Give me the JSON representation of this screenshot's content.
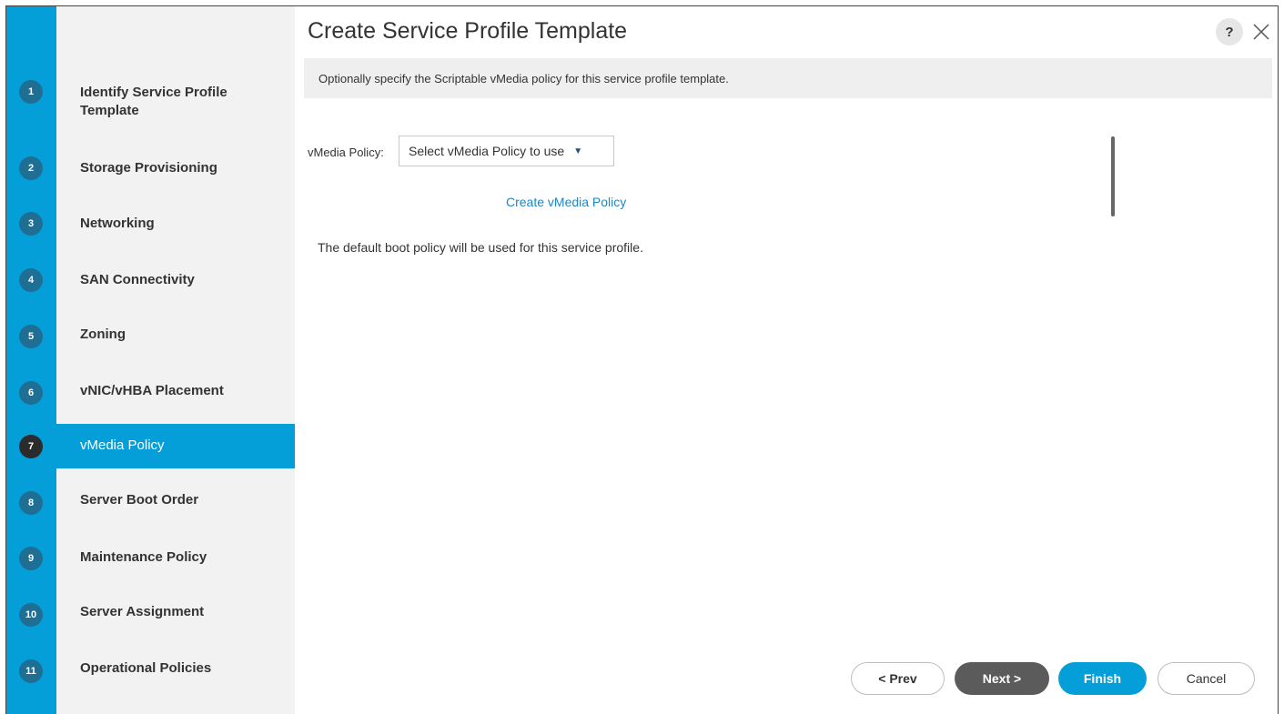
{
  "dialog": {
    "title": "Create Service Profile Template",
    "help_label": "?",
    "accent_color": "#049fd9"
  },
  "steps": [
    {
      "number": "1",
      "label": "Identify Service Profile Template",
      "active": false
    },
    {
      "number": "2",
      "label": "Storage Provisioning",
      "active": false
    },
    {
      "number": "3",
      "label": "Networking",
      "active": false
    },
    {
      "number": "4",
      "label": "SAN Connectivity",
      "active": false
    },
    {
      "number": "5",
      "label": "Zoning",
      "active": false
    },
    {
      "number": "6",
      "label": "vNIC/vHBA Placement",
      "active": false
    },
    {
      "number": "7",
      "label": "vMedia Policy",
      "active": true
    },
    {
      "number": "8",
      "label": "Server Boot Order",
      "active": false
    },
    {
      "number": "9",
      "label": "Maintenance Policy",
      "active": false
    },
    {
      "number": "10",
      "label": "Server Assignment",
      "active": false
    },
    {
      "number": "11",
      "label": "Operational Policies",
      "active": false
    }
  ],
  "content": {
    "description": "Optionally specify the Scriptable vMedia policy for this service profile template.",
    "vmedia_label": "vMedia Policy:",
    "vmedia_select_value": "Select vMedia Policy to use",
    "create_link": "Create vMedia Policy",
    "info_text": "The default boot policy will be used for this service profile."
  },
  "footer": {
    "prev_label": "< Prev",
    "next_label": "Next >",
    "finish_label": "Finish",
    "cancel_label": "Cancel"
  }
}
